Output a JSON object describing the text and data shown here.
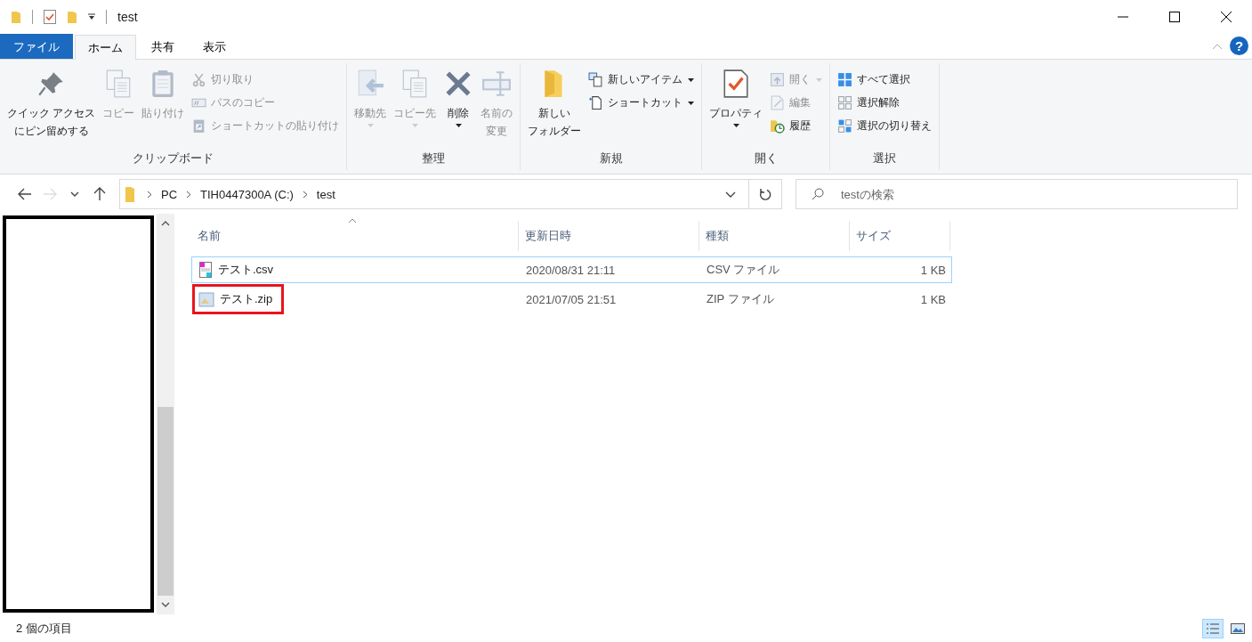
{
  "window": {
    "title": "test"
  },
  "tabs": [
    {
      "label": "ファイル",
      "kind": "file",
      "selected": false
    },
    {
      "label": "ホーム",
      "kind": "tab",
      "selected": true
    },
    {
      "label": "共有",
      "kind": "tab",
      "selected": false
    },
    {
      "label": "表示",
      "kind": "tab",
      "selected": false
    }
  ],
  "help": {
    "label": "?"
  },
  "ribbon": {
    "groups": [
      {
        "label": "クリップボード",
        "columns": [
          {
            "kind": "large",
            "items": [
              {
                "lines": [
                  "クイック アクセス",
                  "にピン留めする"
                ],
                "disabled": false,
                "dropdown": false
              }
            ]
          },
          {
            "kind": "large",
            "items": [
              {
                "label": "コピー",
                "disabled": true,
                "dropdown": false
              }
            ]
          },
          {
            "kind": "large",
            "items": [
              {
                "label": "貼り付け",
                "disabled": true,
                "dropdown": false
              }
            ]
          },
          {
            "kind": "stack",
            "items": [
              {
                "label": "切り取り",
                "disabled": true,
                "dropdown": false
              },
              {
                "label": "パスのコピー",
                "disabled": true,
                "dropdown": false
              },
              {
                "label": "ショートカットの貼り付け",
                "disabled": true,
                "dropdown": false
              }
            ]
          }
        ]
      },
      {
        "label": "整理",
        "columns": [
          {
            "kind": "large",
            "items": [
              {
                "label": "移動先",
                "disabled": true,
                "dropdown": true
              }
            ]
          },
          {
            "kind": "large",
            "items": [
              {
                "label": "コピー先",
                "disabled": true,
                "dropdown": true
              }
            ]
          },
          {
            "kind": "large",
            "items": [
              {
                "label": "削除",
                "disabled": false,
                "dropdown": true
              }
            ]
          },
          {
            "kind": "large",
            "items": [
              {
                "lines": [
                  "名前の",
                  "変更"
                ],
                "disabled": true,
                "dropdown": false
              }
            ]
          }
        ]
      },
      {
        "label": "新規",
        "columns": [
          {
            "kind": "large",
            "items": [
              {
                "lines": [
                  "新しい",
                  "フォルダー"
                ],
                "disabled": false,
                "dropdown": false
              }
            ]
          },
          {
            "kind": "stack",
            "items": [
              {
                "label": "新しいアイテム",
                "disabled": false,
                "dropdown": true
              },
              {
                "label": "ショートカット",
                "disabled": false,
                "dropdown": true
              }
            ]
          }
        ]
      },
      {
        "label": "開く",
        "columns": [
          {
            "kind": "large",
            "items": [
              {
                "label": "プロパティ",
                "disabled": false,
                "dropdown": true
              }
            ]
          },
          {
            "kind": "stack",
            "items": [
              {
                "label": "開く",
                "disabled": true,
                "dropdown": true
              },
              {
                "label": "編集",
                "disabled": true,
                "dropdown": false
              },
              {
                "label": "履歴",
                "disabled": false,
                "dropdown": false
              }
            ]
          }
        ]
      },
      {
        "label": "選択",
        "columns": [
          {
            "kind": "stack",
            "items": [
              {
                "label": "すべて選択",
                "disabled": false,
                "dropdown": false
              },
              {
                "label": "選択解除",
                "disabled": false,
                "dropdown": false
              },
              {
                "label": "選択の切り替え",
                "disabled": false,
                "dropdown": false
              }
            ]
          }
        ]
      }
    ]
  },
  "navigation": [
    {
      "kind": "back",
      "disabled": false
    },
    {
      "kind": "forward",
      "disabled": true
    },
    {
      "kind": "recent",
      "disabled": false
    },
    {
      "kind": "up",
      "disabled": false
    }
  ],
  "address": {
    "path": [
      "PC",
      "TIH0447300A (C:)",
      "test"
    ]
  },
  "search": {
    "placeholder": "testの検索"
  },
  "table": {
    "columns": [
      "名前",
      "更新日時",
      "種類",
      "サイズ"
    ],
    "rows": [
      {
        "name": "テスト.csv",
        "modified": "2020/08/31 21:11",
        "type": "CSV ファイル",
        "size": "1 KB",
        "kind": "csv",
        "focused": true,
        "highlighted": false
      },
      {
        "name": "テスト.zip",
        "modified": "2021/07/05 21:51",
        "type": "ZIP ファイル",
        "size": "1 KB",
        "kind": "zip",
        "focused": false,
        "highlighted": true
      }
    ]
  },
  "status_bar": {
    "text": "2 個の項目",
    "views": [
      {
        "kind": "details",
        "selected": true
      },
      {
        "kind": "large-icons",
        "selected": false
      }
    ]
  }
}
